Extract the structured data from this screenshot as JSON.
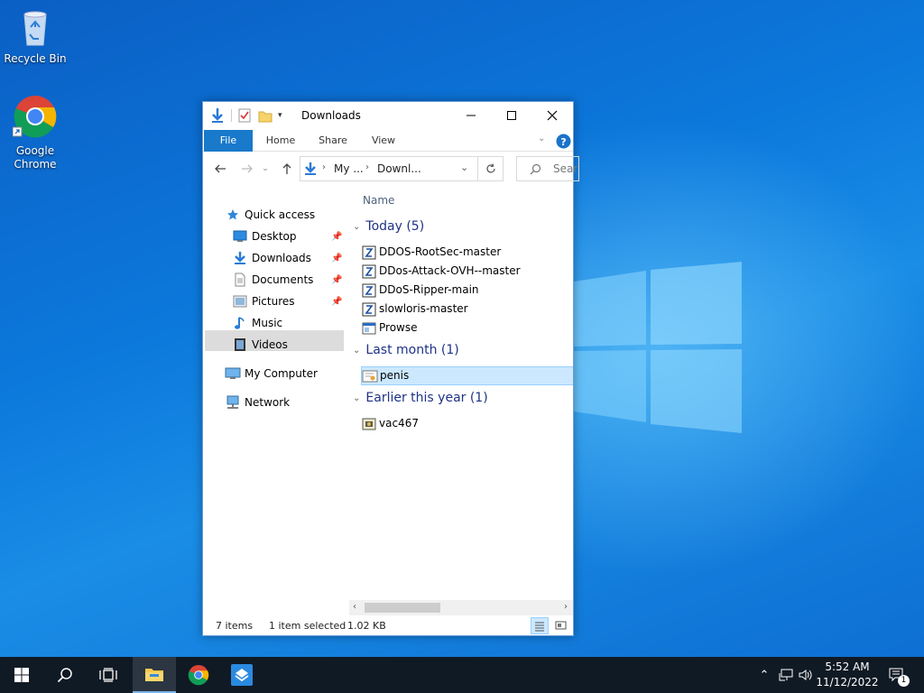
{
  "desktop": {
    "icons": [
      {
        "label": "Recycle Bin",
        "icon": "recycle-bin-icon"
      },
      {
        "label": "Google\nChrome",
        "label_line1": "Google",
        "label_line2": "Chrome",
        "icon": "chrome-icon"
      }
    ]
  },
  "window": {
    "title": "Downloads",
    "ribbon": {
      "tabs": [
        "File",
        "Home",
        "Share",
        "View"
      ],
      "active_tab_color": "#1979ca"
    },
    "address": {
      "crumbs": [
        "My ...",
        "Downl..."
      ],
      "search_placeholder": "Sear"
    },
    "nav_pane": {
      "quick_access": "Quick access",
      "items": [
        {
          "label": "Desktop",
          "pinned": true,
          "icon": "desktop-folder-icon"
        },
        {
          "label": "Downloads",
          "pinned": true,
          "selected": true,
          "icon": "downloads-folder-icon"
        },
        {
          "label": "Documents",
          "pinned": true,
          "icon": "documents-folder-icon"
        },
        {
          "label": "Pictures",
          "pinned": true,
          "icon": "pictures-folder-icon"
        },
        {
          "label": "Music",
          "pinned": false,
          "icon": "music-folder-icon"
        },
        {
          "label": "Videos",
          "pinned": false,
          "icon": "videos-folder-icon"
        }
      ],
      "my_computer": "My Computer",
      "network": "Network"
    },
    "files": {
      "column_name": "Name",
      "groups": [
        {
          "label": "Today (5)",
          "items": [
            {
              "name": "DDOS-RootSec-master",
              "icon": "zip-folder-icon"
            },
            {
              "name": "DDos-Attack-OVH--master",
              "icon": "zip-folder-icon"
            },
            {
              "name": "DDoS-Ripper-main",
              "icon": "zip-folder-icon"
            },
            {
              "name": "slowloris-master",
              "icon": "zip-folder-icon"
            },
            {
              "name": "Prowse",
              "icon": "application-icon"
            }
          ]
        },
        {
          "label": "Last month (1)",
          "items": [
            {
              "name": "penis",
              "icon": "certificate-icon",
              "selected": true
            }
          ]
        },
        {
          "label": "Earlier this year (1)",
          "items": [
            {
              "name": "vac467",
              "icon": "executable-icon"
            }
          ]
        }
      ]
    },
    "status": {
      "item_count": "7 items",
      "selection": "1 item selected",
      "size": "1.02 KB"
    }
  },
  "taskbar": {
    "time": "5:52 AM",
    "date": "11/12/2022",
    "notification_count": "1"
  }
}
